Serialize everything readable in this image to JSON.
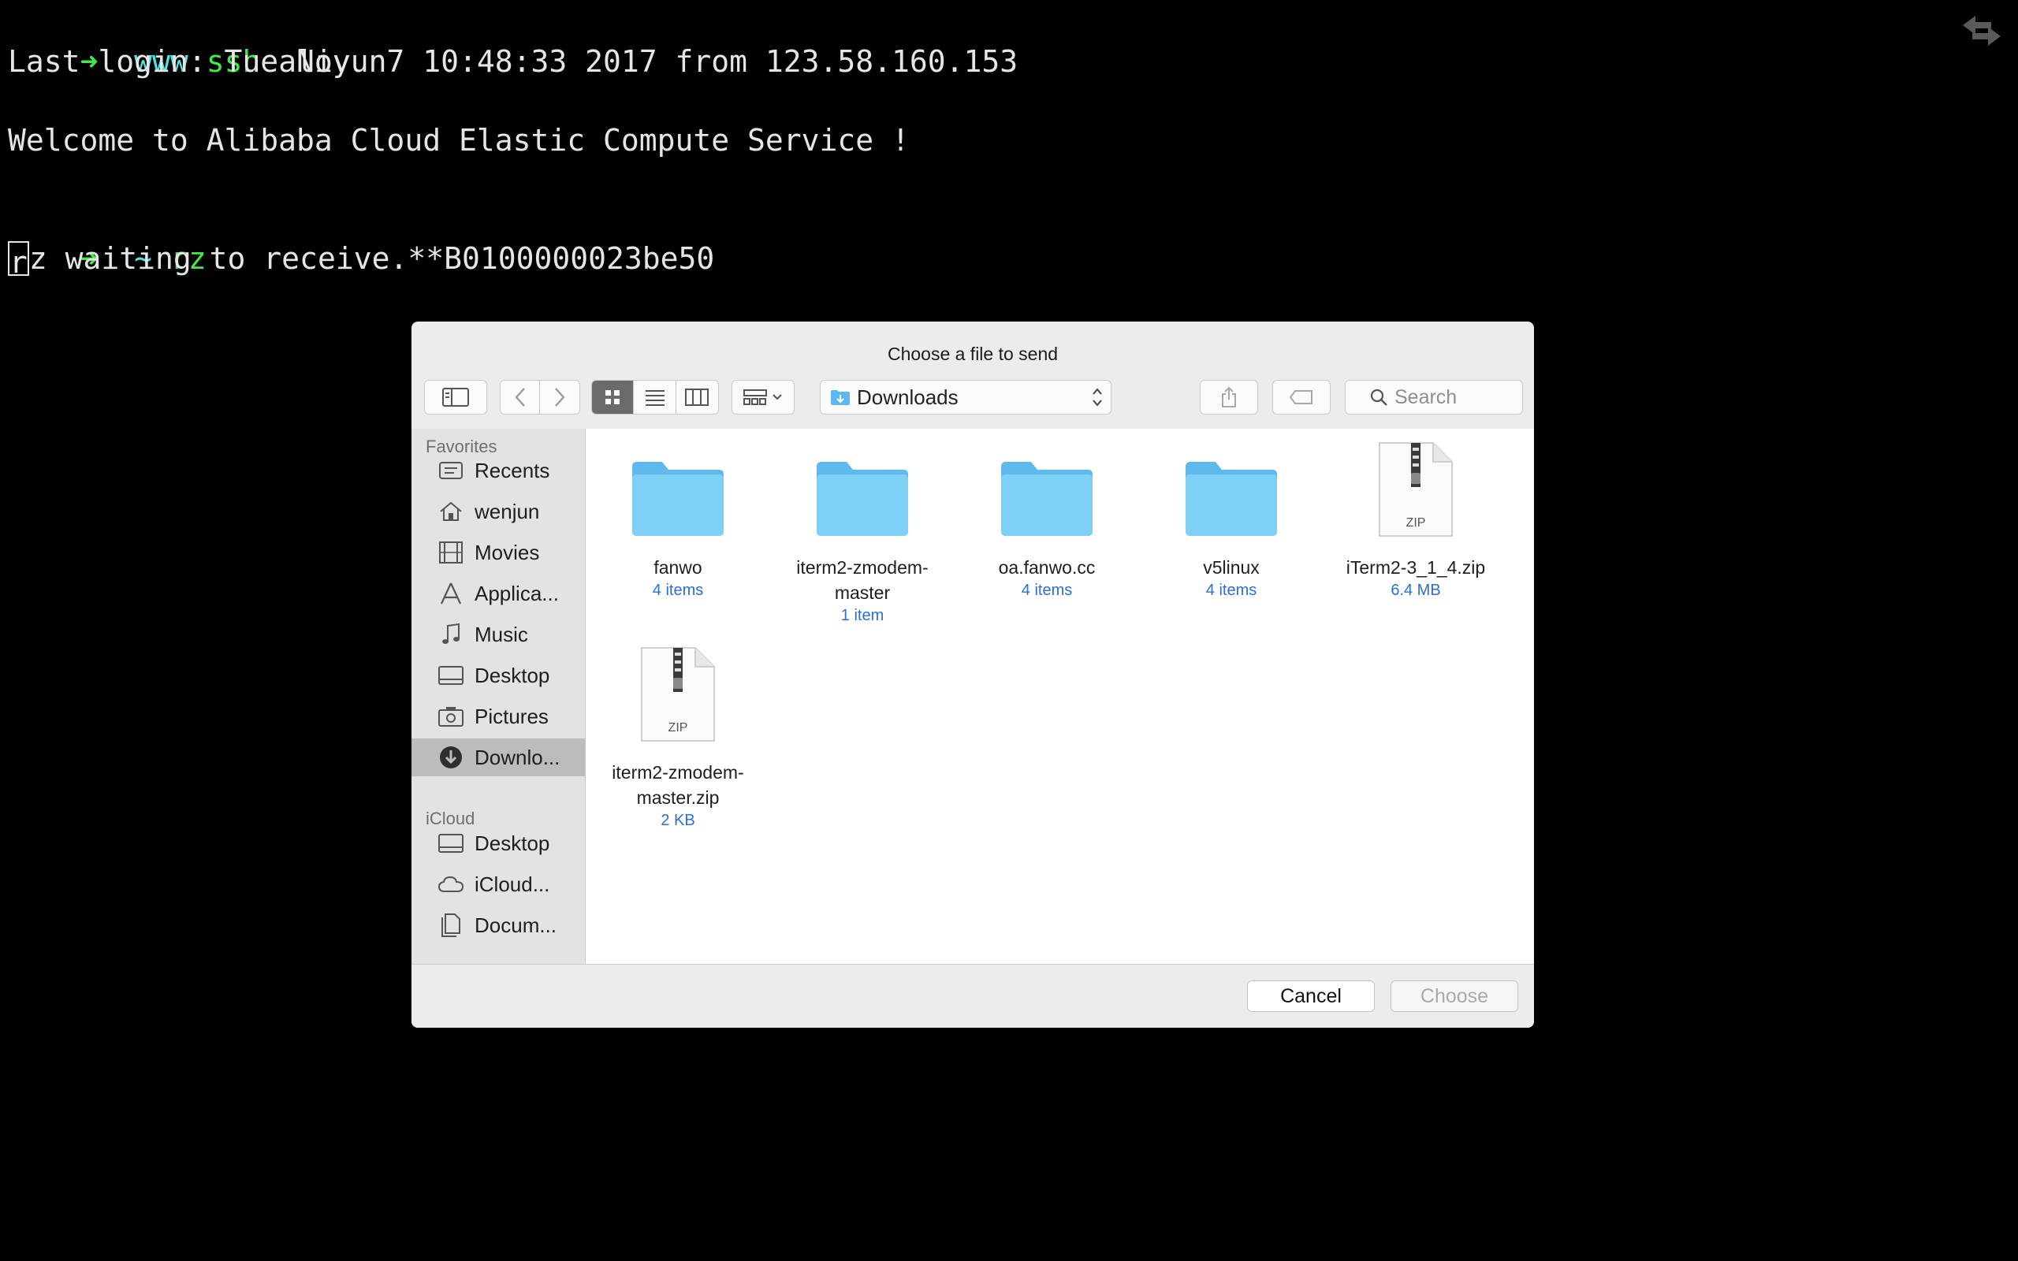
{
  "terminal": {
    "line1": {
      "prompt": "➜",
      "dir": "www",
      "cmd": "ssh",
      "arg": "aliyun"
    },
    "line2": "Last login: Tue Nov  7 10:48:33 2017 from 123.58.160.153",
    "line3": "Welcome to Alibaba Cloud Elastic Compute Service !",
    "line4": {
      "prompt": "➜",
      "dir": "~",
      "cmd": "rz"
    },
    "line5": {
      "cursor_char": "r",
      "rest": "z waiting to receive.**B0100000023be50"
    }
  },
  "dialog": {
    "title": "Choose a file to send",
    "location": "Downloads",
    "search_placeholder": "Search",
    "view_mode": "icon",
    "sidebar": {
      "favorites_header": "Favorites",
      "favorites": [
        {
          "label": "Recents",
          "icon": "recents-icon"
        },
        {
          "label": "wenjun",
          "icon": "home-icon"
        },
        {
          "label": "Movies",
          "icon": "movies-icon"
        },
        {
          "label": "Applica...",
          "icon": "applications-icon"
        },
        {
          "label": "Music",
          "icon": "music-icon"
        },
        {
          "label": "Desktop",
          "icon": "desktop-icon"
        },
        {
          "label": "Pictures",
          "icon": "pictures-icon"
        },
        {
          "label": "Downlo...",
          "icon": "downloads-icon",
          "selected": true
        }
      ],
      "icloud_header": "iCloud",
      "icloud": [
        {
          "label": "Desktop",
          "icon": "desktop-icon"
        },
        {
          "label": "iCloud...",
          "icon": "icloud-icon"
        },
        {
          "label": "Docum...",
          "icon": "documents-icon"
        }
      ]
    },
    "files": [
      {
        "name": "fanwo",
        "meta": "4 items",
        "type": "folder"
      },
      {
        "name": "iterm2-zmodem-master",
        "meta": "1 item",
        "type": "folder"
      },
      {
        "name": "oa.fanwo.cc",
        "meta": "4 items",
        "type": "folder"
      },
      {
        "name": "v5linux",
        "meta": "4 items",
        "type": "folder"
      },
      {
        "name": "iTerm2-3_1_4.zip",
        "meta": "6.4 MB",
        "type": "zip"
      },
      {
        "name": "iterm2-zmodem-master.zip",
        "meta": "2 KB",
        "type": "zip"
      }
    ],
    "zip_label": "ZIP",
    "cancel_label": "Cancel",
    "choose_label": "Choose"
  },
  "colors": {
    "prompt_green": "#43e84a",
    "dir_cyan": "#4fe6e6",
    "folder_blue": "#6ecbf5",
    "meta_blue": "#2c6fd1"
  }
}
